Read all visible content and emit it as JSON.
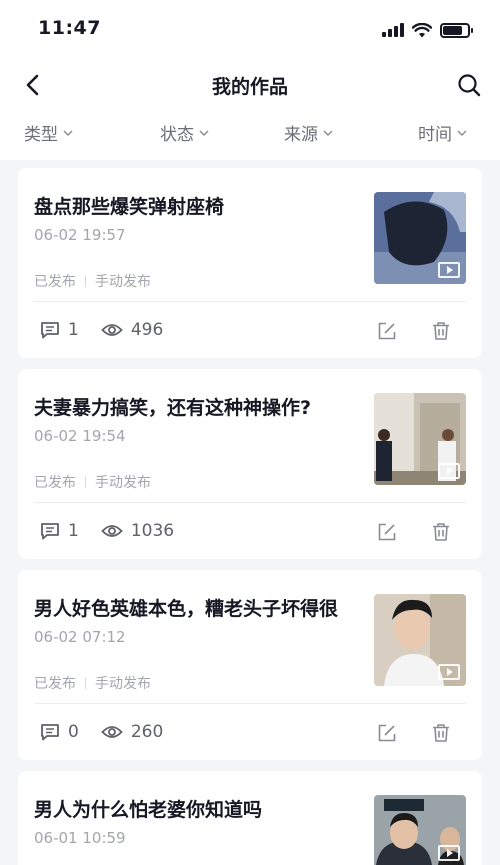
{
  "status_bar": {
    "time": "11:47"
  },
  "nav": {
    "title": "我的作品",
    "back_icon": "back-arrow-icon",
    "search_icon": "search-icon"
  },
  "filters": [
    {
      "label": "类型"
    },
    {
      "label": "状态"
    },
    {
      "label": "来源"
    },
    {
      "label": "时间"
    }
  ],
  "works": [
    {
      "title": "盘点那些爆笑弹射座椅",
      "date": "06-02 19:57",
      "status": "已发布",
      "source": "手动发布",
      "comments": "1",
      "views": "496"
    },
    {
      "title": "夫妻暴力搞笑，还有这种神操作?",
      "date": "06-02 19:54",
      "status": "已发布",
      "source": "手动发布",
      "comments": "1",
      "views": "1036"
    },
    {
      "title": "男人好色英雄本色，糟老头子坏得很",
      "date": "06-02 07:12",
      "status": "已发布",
      "source": "手动发布",
      "comments": "0",
      "views": "260"
    },
    {
      "title": "男人为什么怕老婆你知道吗",
      "date": "06-01 10:59",
      "status": "已发布",
      "source": "手动发布",
      "comments": "",
      "views": ""
    }
  ]
}
